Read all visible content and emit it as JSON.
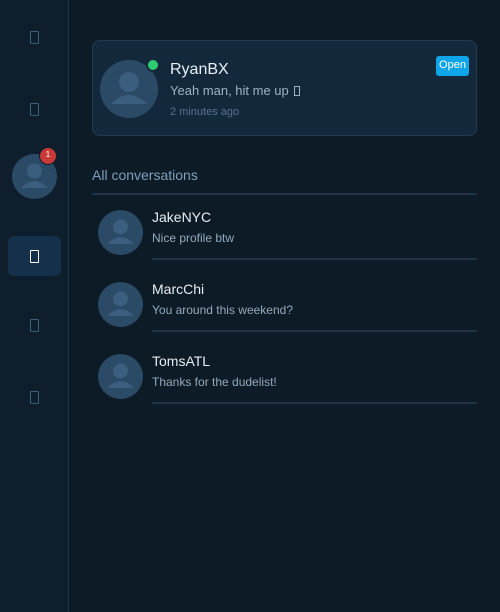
{
  "sidebar": {
    "items": [
      {
        "icon": "nav-icon"
      },
      {
        "icon": "nav-icon"
      },
      {
        "icon": "chat-icon",
        "active": true
      },
      {
        "icon": "nav-icon"
      },
      {
        "icon": "nav-icon"
      }
    ],
    "notification_count": "1"
  },
  "recent": {
    "name": "RyanBX",
    "message": "Yeah man, hit me up",
    "time": "2 minutes ago",
    "open_label": "Open",
    "status": "online"
  },
  "conversations": {
    "title": "All conversations",
    "items": [
      {
        "name": "JakeNYC",
        "message": "Nice profile btw"
      },
      {
        "name": "MarcChi",
        "message": "You around this weekend?"
      },
      {
        "name": "TomsATL",
        "message": "Thanks for the dudelist!"
      }
    ]
  },
  "colors": {
    "background": "#0d1b27",
    "accent": "#0ea5e9",
    "online": "#2ecc71",
    "badge": "#c83a37"
  }
}
